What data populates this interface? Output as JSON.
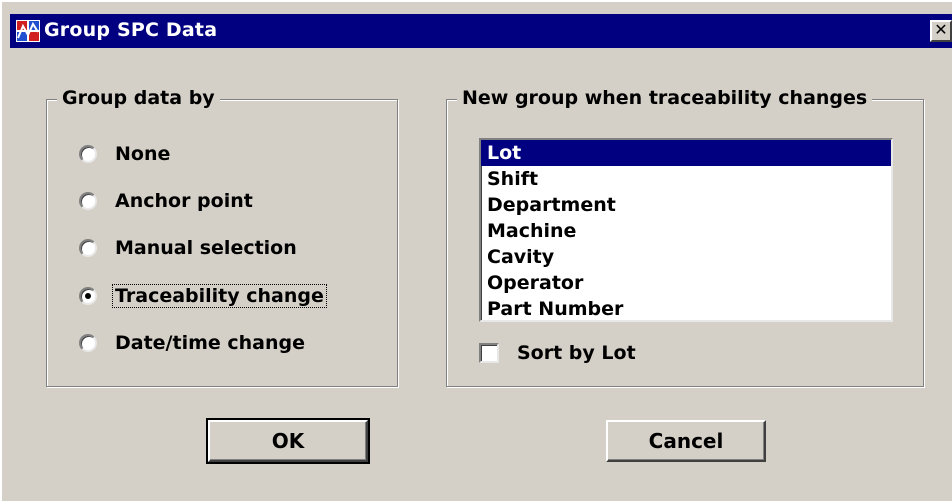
{
  "window": {
    "title": "Group SPC Data",
    "close_glyph": "✕",
    "app_icon": "spc-chart-icon"
  },
  "group_by": {
    "label": "Group data by",
    "options": [
      {
        "label": "None",
        "checked": false
      },
      {
        "label": "Anchor point",
        "checked": false
      },
      {
        "label": "Manual selection",
        "checked": false
      },
      {
        "label": "Traceability change",
        "checked": true
      },
      {
        "label": "Date/time change",
        "checked": false
      }
    ]
  },
  "traceability": {
    "label": "New group when traceability changes",
    "items": [
      "Lot",
      "Shift",
      "Department",
      "Machine",
      "Cavity",
      "Operator",
      "Part Number"
    ],
    "selected": "Lot",
    "sort_label": "Sort by Lot",
    "sort_checked": false
  },
  "buttons": {
    "ok": "OK",
    "cancel": "Cancel"
  },
  "colors": {
    "titlebar": "#000080",
    "face": "#d4d0c8",
    "selection": "#000080"
  }
}
